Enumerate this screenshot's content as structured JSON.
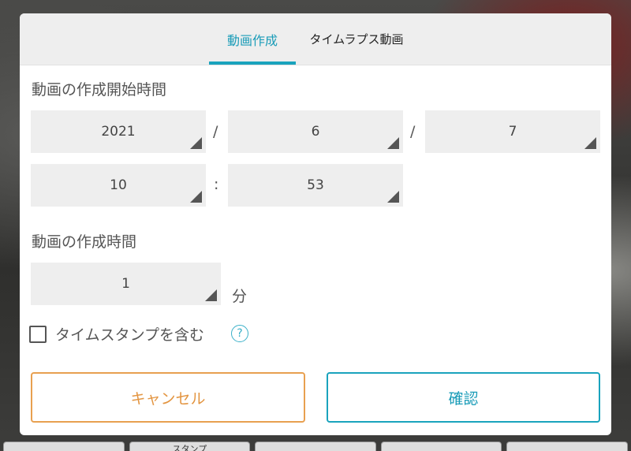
{
  "tabs": {
    "video_creation": "動画作成",
    "timelapse": "タイムラプス動画"
  },
  "start": {
    "label": "動画の作成開始時間",
    "year": "2021",
    "month": "6",
    "day": "7",
    "hour": "10",
    "minute": "53",
    "date_separator": "/",
    "time_separator": ":"
  },
  "duration": {
    "label": "動画の作成時間",
    "value": "1",
    "unit": "分"
  },
  "timestamp": {
    "label": "タイムスタンプを含む",
    "checked": false,
    "help_glyph": "?"
  },
  "buttons": {
    "cancel": "キャンセル",
    "confirm": "確認"
  },
  "background_strip": [
    "",
    "スタンプ",
    "",
    "",
    ""
  ],
  "colors": {
    "accent": "#1aa3bd",
    "cancel": "#e39541",
    "select_bg": "#eeeeee"
  }
}
